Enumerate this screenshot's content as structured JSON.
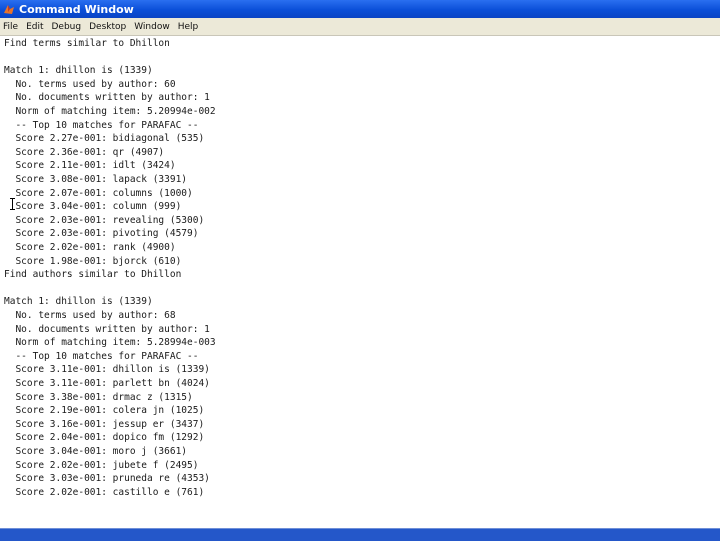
{
  "window": {
    "title": "Command Window"
  },
  "menu": [
    "File",
    "Edit",
    "Debug",
    "Desktop",
    "Window",
    "Help"
  ],
  "console": {
    "lines": [
      "Find terms similar to Dhillon",
      "",
      "Match 1: dhillon is (1339)",
      "  No. terms used by author: 60",
      "  No. documents written by author: 1",
      "  Norm of matching item: 5.20994e-002",
      "  -- Top 10 matches for PARAFAC --",
      "  Score 2.27e-001: bidiagonal (535)",
      "  Score 2.36e-001: qr (4907)",
      "  Score 2.11e-001: idlt (3424)",
      "  Score 3.08e-001: lapack (3391)",
      "  Score 2.07e-001: columns (1000)",
      "  Score 3.04e-001: column (999)",
      "  Score 2.03e-001: revealing (5300)",
      "  Score 2.03e-001: pivoting (4579)",
      "  Score 2.02e-001: rank (4900)",
      "  Score 1.98e-001: bjorck (610)",
      "Find authors similar to Dhillon",
      "",
      "Match 1: dhillon is (1339)",
      "  No. terms used by author: 68",
      "  No. documents written by author: 1",
      "  Norm of matching item: 5.28994e-003",
      "  -- Top 10 matches for PARAFAC --",
      "  Score 3.11e-001: dhillon is (1339)",
      "  Score 3.11e-001: parlett bn (4024)",
      "  Score 3.38e-001: drmac z (1315)",
      "  Score 2.19e-001: colera jn (1025)",
      "  Score 3.16e-001: jessup er (3437)",
      "  Score 2.04e-001: dopico fm (1292)",
      "  Score 3.04e-001: moro j (3661)",
      "  Score 2.02e-001: jubete f (2495)",
      "  Score 3.03e-001: pruneda re (4353)",
      "  Score 2.02e-001: castillo e (761)"
    ]
  }
}
